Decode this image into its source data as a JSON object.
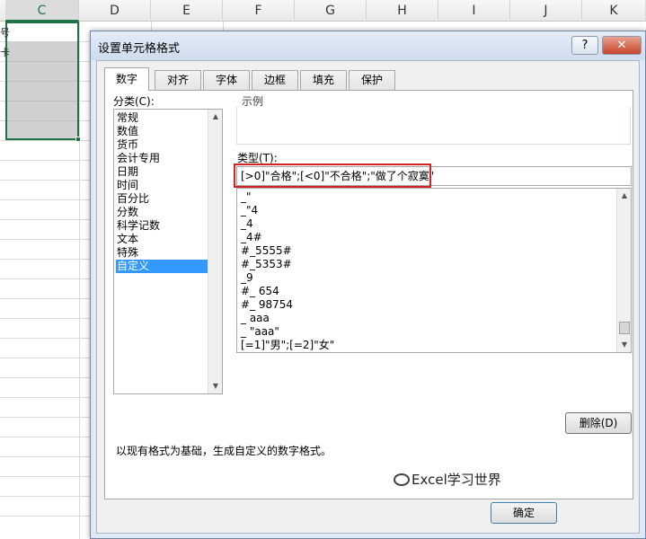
{
  "sheet": {
    "columns": [
      "C",
      "D",
      "E",
      "F",
      "G",
      "H",
      "I",
      "J",
      "K"
    ],
    "row_fragments": [
      "号",
      "卡"
    ]
  },
  "dialog": {
    "title": "设置单元格格式",
    "help_label": "?",
    "close_label": "✕",
    "tabs": [
      {
        "label": "数字",
        "active": true
      },
      {
        "label": "对齐",
        "active": false
      },
      {
        "label": "字体",
        "active": false
      },
      {
        "label": "边框",
        "active": false
      },
      {
        "label": "填充",
        "active": false
      },
      {
        "label": "保护",
        "active": false
      }
    ],
    "category_label": "分类(C):",
    "categories": [
      "常规",
      "数值",
      "货币",
      "会计专用",
      "日期",
      "时间",
      "百分比",
      "分数",
      "科学记数",
      "文本",
      "特殊",
      "自定义"
    ],
    "selected_category": "自定义",
    "sample_label": "示例",
    "type_label": "类型(T):",
    "type_value": "[>0]\"合格\";[<0]\"不合格\";\"做了个寂寞\"",
    "format_list": [
      "_\"",
      "_\"4",
      "_4",
      "_4#",
      "#_5555#",
      "#_5353#",
      "_9",
      "#_ 654",
      "#_ 98754",
      "_ aaa",
      "_ \"aaa\"",
      "[=1]\"男\";[=2]\"女\""
    ],
    "delete_button": "删除(D)",
    "description": "以现有格式为基础，生成自定义的数字格式。",
    "ok_button": "确定",
    "watermark": "Excel学习世界"
  },
  "colors": {
    "selection_border": "#217346",
    "highlight_border": "#d32323",
    "selected_item_bg": "#3399ff"
  }
}
